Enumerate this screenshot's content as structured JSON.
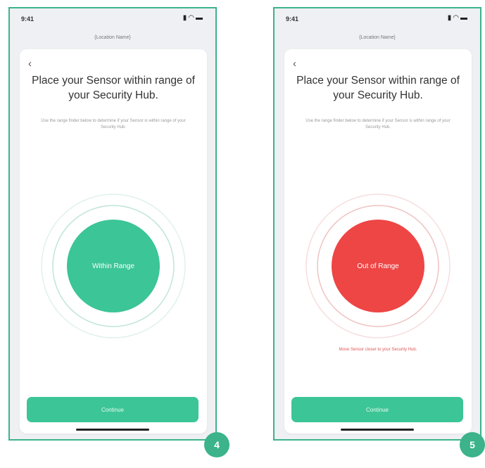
{
  "screens": [
    {
      "status_time": "9:41",
      "location_name": "{Location Name}",
      "title": "Place your Sensor within range of your Security Hub.",
      "subtitle": "Use the range finder below to determine if your Sensor is within range of your Security Hub.",
      "range_label": "Within Range",
      "range_color": "#3cc596",
      "continue_label": "Continue",
      "step": "4"
    },
    {
      "status_time": "9:41",
      "location_name": "{Location Name}",
      "title": "Place your Sensor within range of your Security Hub.",
      "subtitle": "Use the range finder below to determine if your Sensor is within range of your Security Hub.",
      "range_label": "Out of Range",
      "range_color": "#ee4545",
      "warning": "Move Sensor closer to your Security Hub.",
      "continue_label": "Continue",
      "step": "5"
    }
  ],
  "icons": {
    "back": "chevron-left-icon",
    "status": [
      "signal-icon",
      "wifi-icon",
      "battery-icon"
    ]
  },
  "colors": {
    "accent": "#3cb38a",
    "success": "#3cc596",
    "danger": "#ee4545"
  }
}
